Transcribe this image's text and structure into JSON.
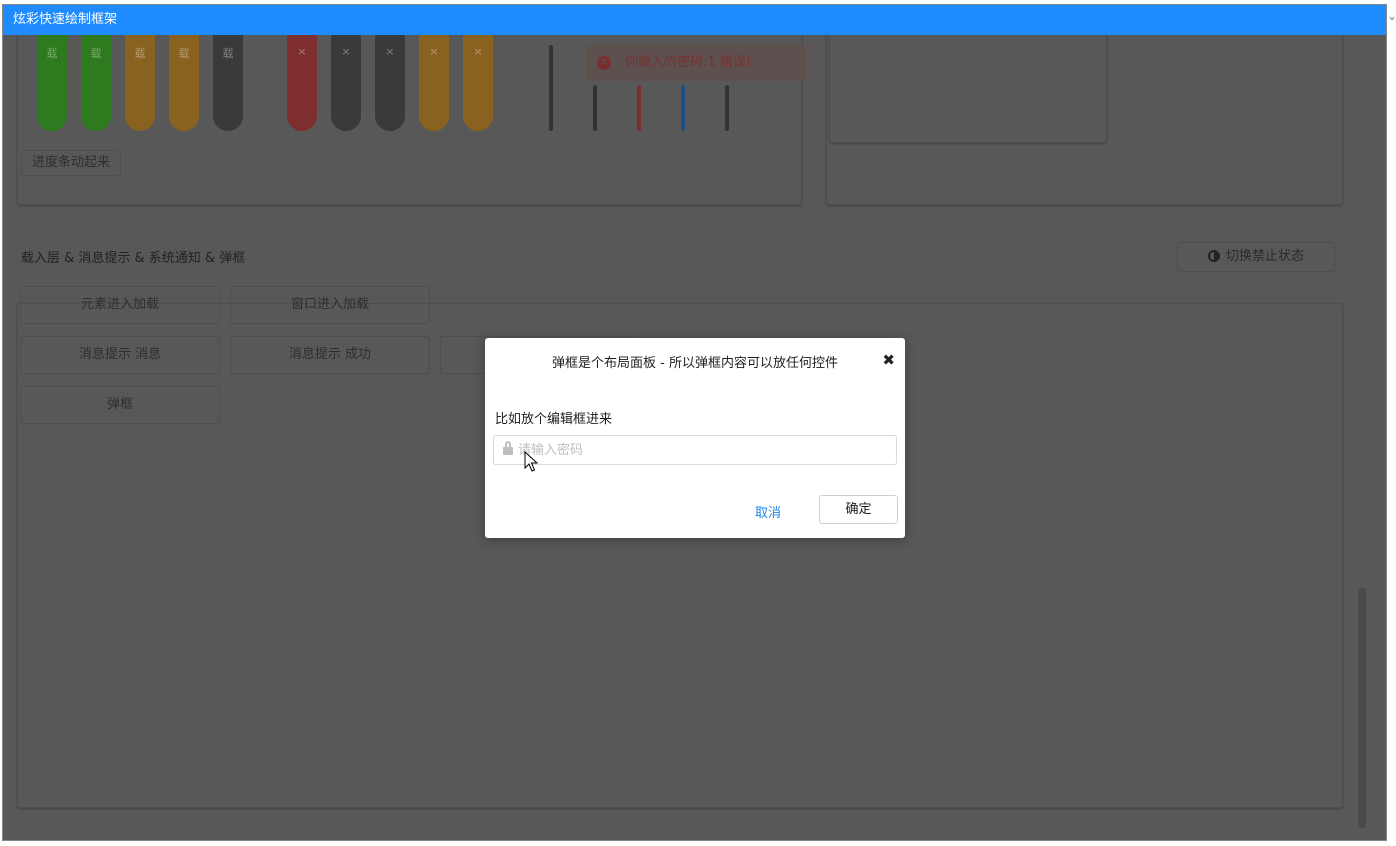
{
  "window": {
    "title": "炫彩快速绘制框架"
  },
  "top_demo": {
    "loading_pills": [
      {
        "label": "载",
        "color": "green"
      },
      {
        "label": "载",
        "color": "green"
      },
      {
        "label": "载",
        "color": "orange"
      },
      {
        "label": "载",
        "color": "orange"
      },
      {
        "label": "载",
        "color": "dark"
      }
    ],
    "close_pills": [
      {
        "label": "×",
        "color": "red"
      },
      {
        "label": "×",
        "color": "dark"
      },
      {
        "label": "×",
        "color": "dark"
      },
      {
        "label": "×",
        "color": "orange"
      },
      {
        "label": "×",
        "color": "orange"
      }
    ],
    "progress_button": "进度条动起来"
  },
  "toast": {
    "text": "你输入的密码:1 错误!"
  },
  "section": {
    "title": "载入层 & 消息提示 & 系统通知 & 弹框",
    "toggle_label": "切换禁止状态",
    "buttons": {
      "element_loading": "元素进入加载",
      "window_loading": "窗口进入加载",
      "msg_info": "消息提示 消息",
      "msg_success": "消息提示 成功",
      "dialog": "弹框"
    }
  },
  "modal": {
    "title": "弹框是个布局面板 - 所以弹框内容可以放任何控件",
    "label": "比如放个编辑框进来",
    "input_placeholder": "请输入密码",
    "input_value": "",
    "cancel_label": "取消",
    "ok_label": "确定"
  }
}
